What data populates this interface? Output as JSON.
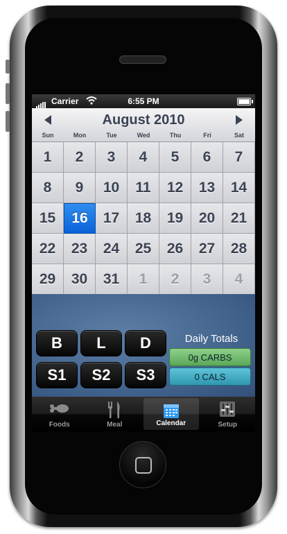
{
  "status_bar": {
    "carrier": "Carrier",
    "time": "6:55 PM"
  },
  "calendar": {
    "month_label": "August 2010",
    "weekdays": [
      "Sun",
      "Mon",
      "Tue",
      "Wed",
      "Thu",
      "Fri",
      "Sat"
    ],
    "days": [
      "1",
      "2",
      "3",
      "4",
      "5",
      "6",
      "7",
      "8",
      "9",
      "10",
      "11",
      "12",
      "13",
      "14",
      "15",
      "16",
      "17",
      "18",
      "19",
      "20",
      "21",
      "22",
      "23",
      "24",
      "25",
      "26",
      "27",
      "28",
      "29",
      "30",
      "31",
      "1",
      "2",
      "3",
      "4"
    ],
    "selected_day": "16"
  },
  "meal_buttons": [
    "B",
    "L",
    "D",
    "S1",
    "S2",
    "S3"
  ],
  "totals": {
    "label": "Daily Totals",
    "carbs": "0g CARBS",
    "cals": "0 CALS"
  },
  "tabs": [
    {
      "label": "Foods",
      "icon": "drumstick-icon"
    },
    {
      "label": "Meal",
      "icon": "fork-knife-icon"
    },
    {
      "label": "Calendar",
      "icon": "calendar-icon"
    },
    {
      "label": "Setup",
      "icon": "sliders-icon"
    }
  ],
  "colors": {
    "selected_day": "#1a78e8",
    "carbs": "#6cbb69",
    "cals": "#3aa7bf",
    "panel": "#4a6b94"
  }
}
